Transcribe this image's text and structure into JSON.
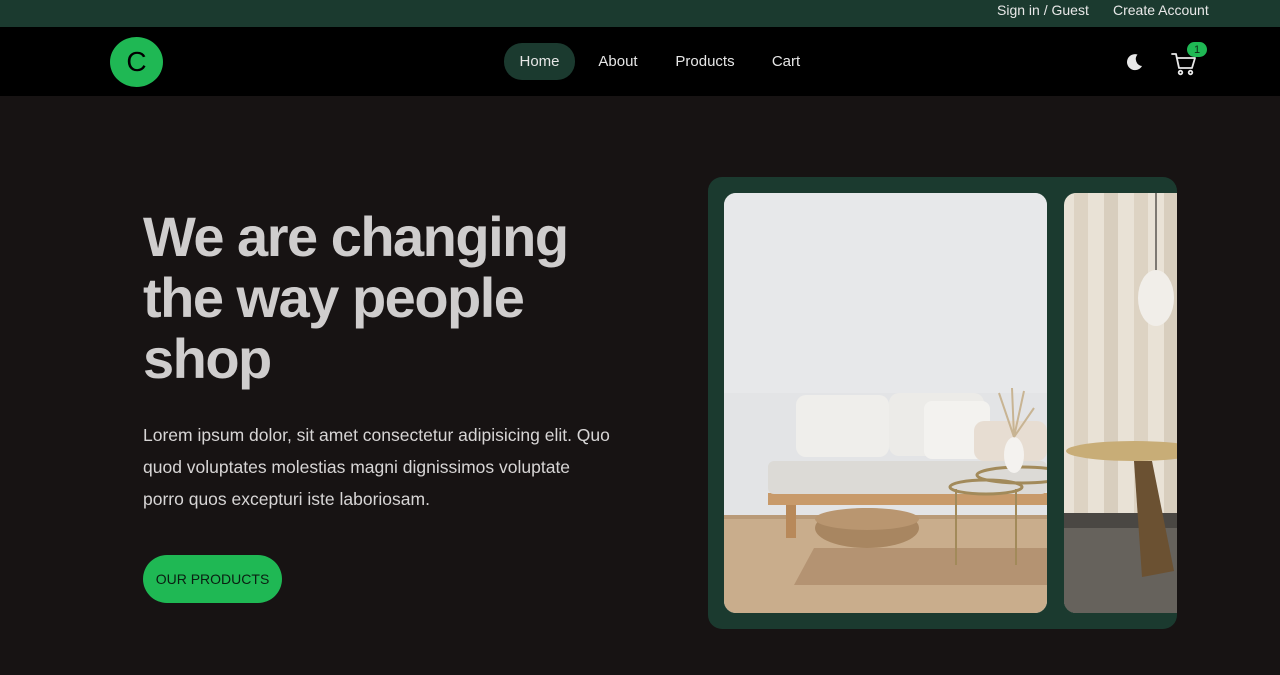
{
  "topbar": {
    "signin": "Sign in / Guest",
    "create_account": "Create Account"
  },
  "nav": {
    "logo": "C",
    "items": [
      {
        "label": "Home",
        "active": true
      },
      {
        "label": "About",
        "active": false
      },
      {
        "label": "Products",
        "active": false
      },
      {
        "label": "Cart",
        "active": false
      }
    ],
    "theme_icon": "moon-icon",
    "cart_icon": "cart-icon",
    "cart_count": "1"
  },
  "hero": {
    "title": "We are changing the way people shop",
    "text": "Lorem ipsum dolor, sit amet consectetur adipisicing elit. Quo quod voluptates molestias magni dignissimos voluptate porro quos excepturi iste laboriosam.",
    "cta": "OUR PRODUCTS"
  },
  "colors": {
    "accent": "#1fb854",
    "topbar": "#1b3a2f",
    "background": "#171313",
    "nav": "#000000"
  }
}
